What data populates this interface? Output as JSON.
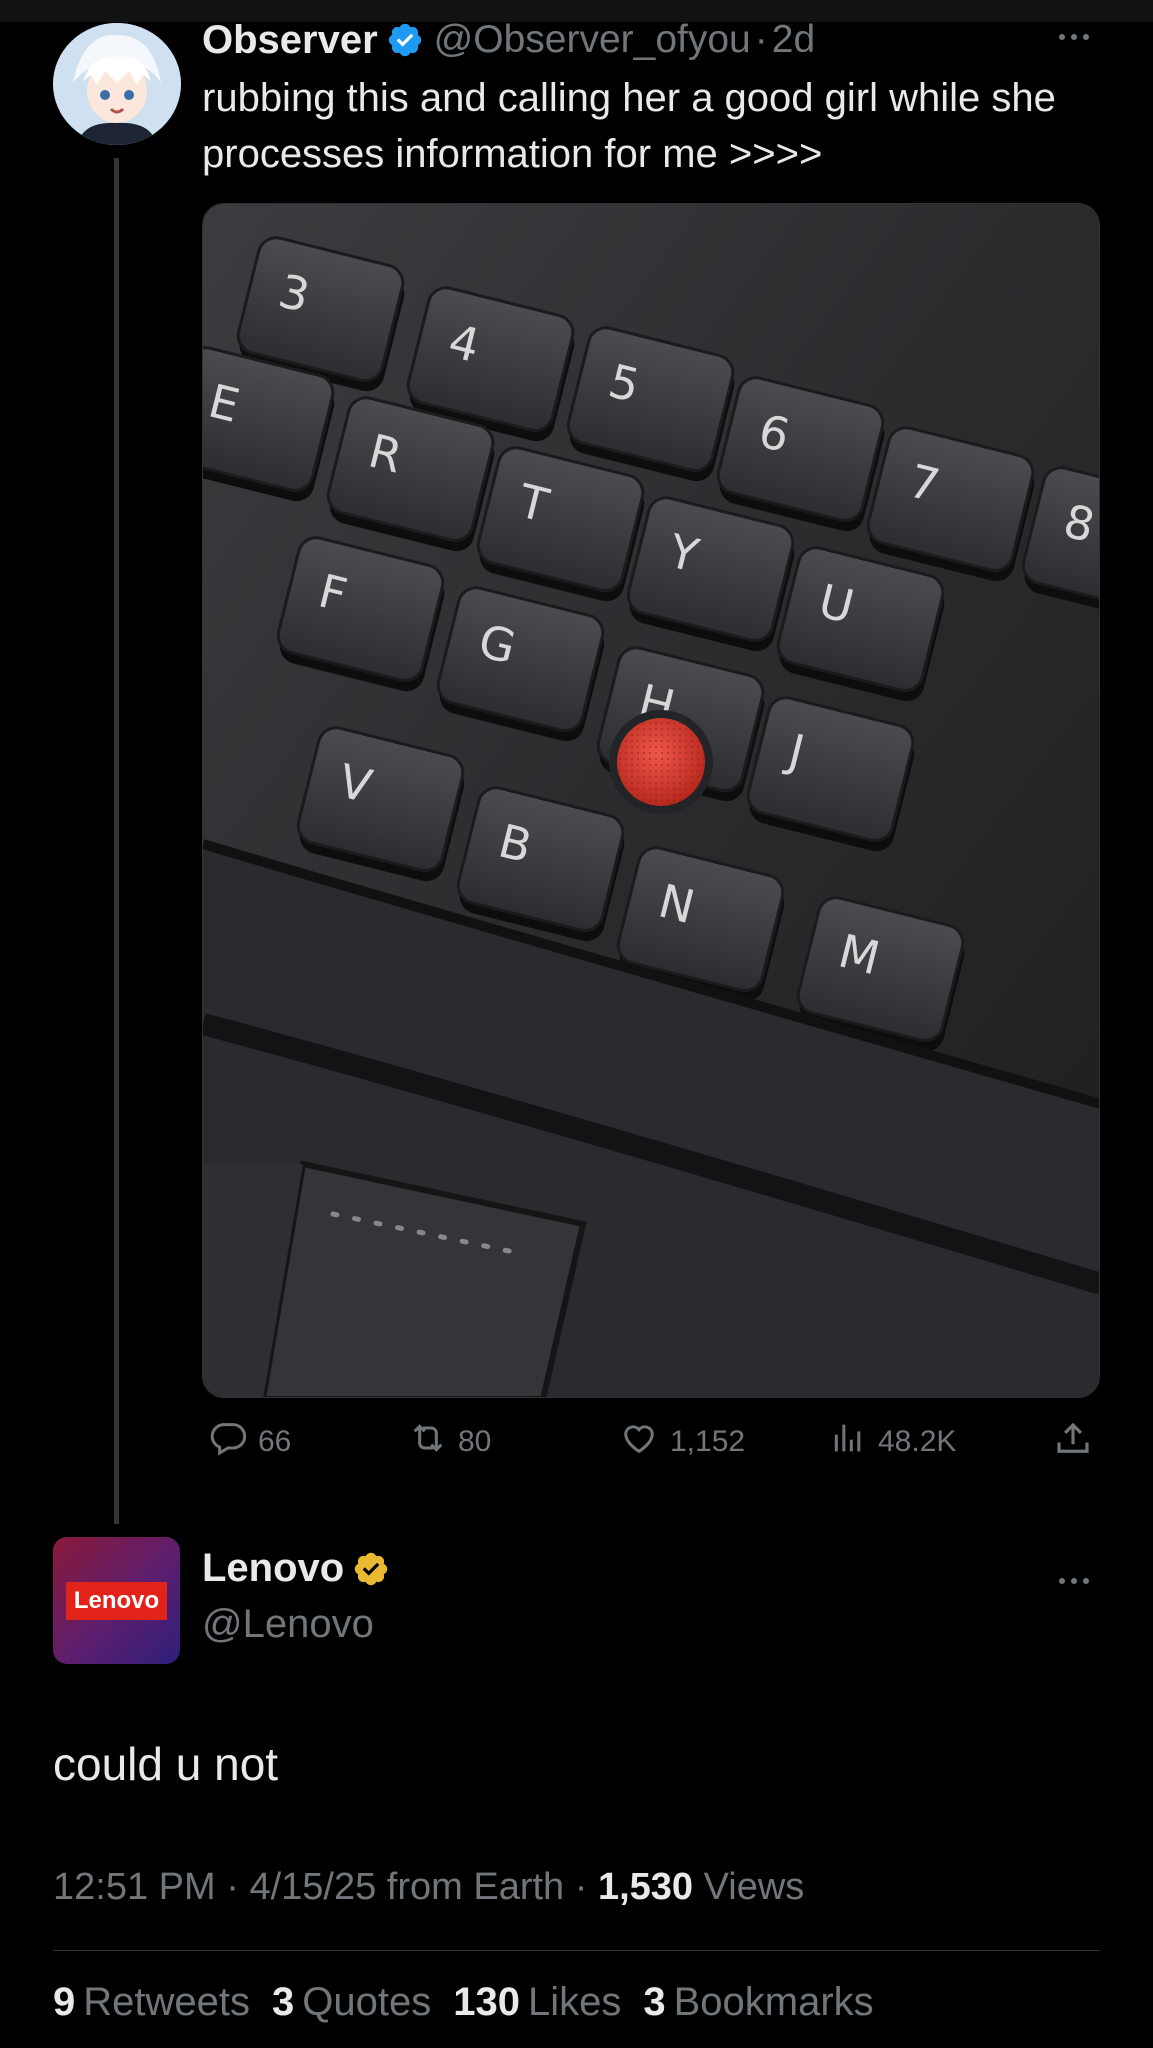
{
  "tweet": {
    "author_name": "Observer",
    "handle": "@Observer_ofyou",
    "separator": "·",
    "age": "2d",
    "text": "rubbing this and calling her a good girl while she processes information for me >>>>",
    "media": {
      "keys": [
        "3",
        "4",
        "5",
        "6",
        "7",
        "8",
        "E",
        "R",
        "T",
        "Y",
        "U",
        "F",
        "G",
        "H",
        "J",
        "V",
        "B",
        "N",
        "M"
      ],
      "key_symbols": [
        "$",
        "%",
        "&",
        "*"
      ],
      "trackpoint_color": "#d63a2e"
    },
    "actions": {
      "replies": "66",
      "retweets": "80",
      "likes": "1,152",
      "views": "48.2K"
    }
  },
  "reply": {
    "author_name": "Lenovo",
    "handle": "@Lenovo",
    "avatar_logo": "Lenovo",
    "text": "could u not",
    "time": "12:51 PM",
    "date": "4/15/25",
    "source": "from Earth",
    "view_count": "1,530",
    "views_label": "Views",
    "stats": [
      {
        "count": "9",
        "label": "Retweets"
      },
      {
        "count": "3",
        "label": "Quotes"
      },
      {
        "count": "130",
        "label": "Likes"
      },
      {
        "count": "3",
        "label": "Bookmarks"
      }
    ]
  },
  "colors": {
    "background": "#000000",
    "primary_text": "#e7e9ea",
    "secondary_text": "#71767b",
    "verified_blue": "#1d9bf0",
    "verified_gold": "#e8b931",
    "lenovo_red": "#e2231a"
  },
  "icons": [
    "verified-badge-icon",
    "more-icon",
    "reply-icon",
    "retweet-icon",
    "like-icon",
    "views-icon",
    "share-icon"
  ]
}
